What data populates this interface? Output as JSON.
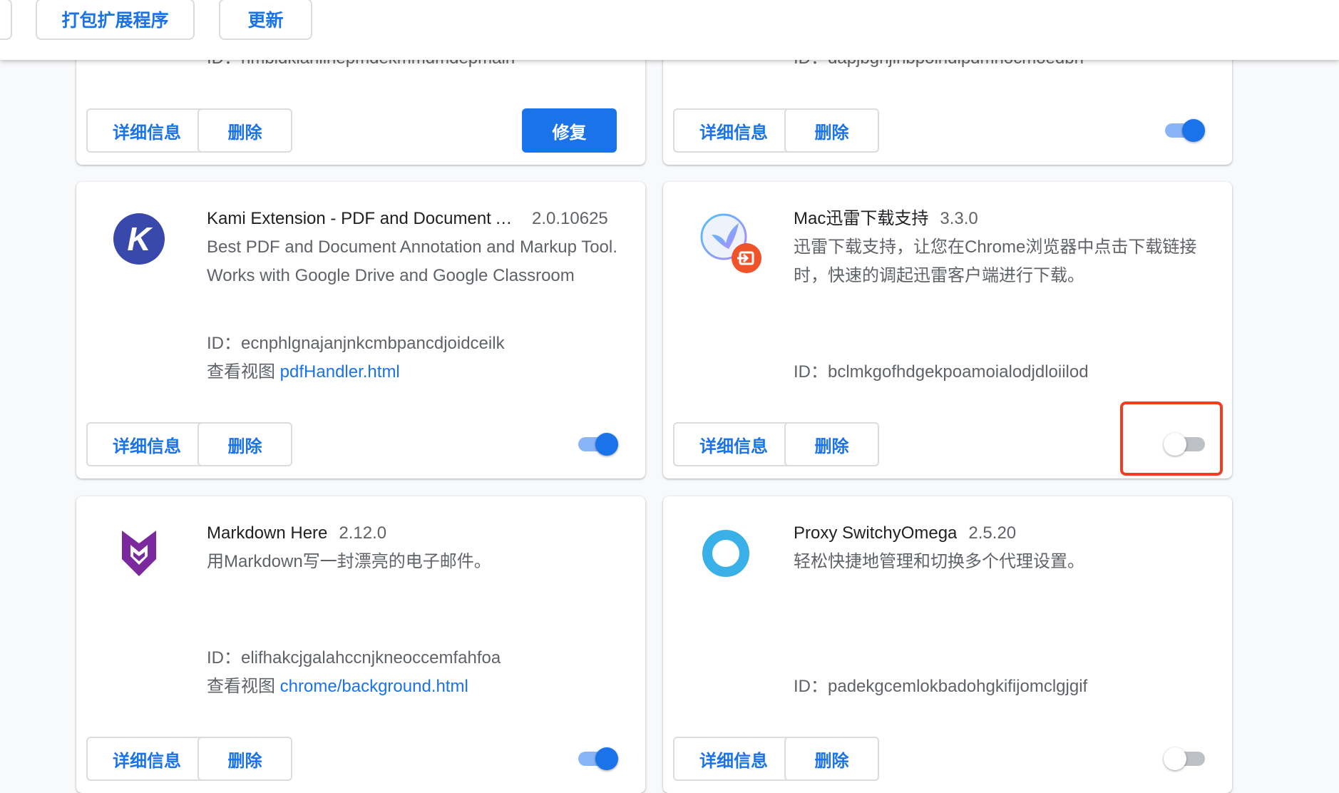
{
  "toolbar": {
    "pack_label": "打包扩展程序",
    "update_label": "更新"
  },
  "common": {
    "details_label": "详细信息",
    "remove_label": "删除",
    "repair_label": "修复",
    "view_label": "查看视图"
  },
  "extensions": [
    {
      "id_line": "ID：hmbldkianlinepmdekmmdmdepmain",
      "state": "corrupted"
    },
    {
      "id_line": "ID：dapjbgnjinbpoindipdmnocmoedbn",
      "enabled": true
    },
    {
      "name": "Kami Extension - PDF and Document Annotation",
      "version": "2.0.10625",
      "description": "Best PDF and Document Annotation and Markup Tool. Works with Google Drive and Google Classroom",
      "id_line": "ID：ecnphlgnajanjnkcmbpancdjoidceilk",
      "view_link": "pdfHandler.html",
      "enabled": true
    },
    {
      "name": "Mac迅雷下载支持",
      "version": "3.3.0",
      "description": "迅雷下载支持，让您在Chrome浏览器中点击下载链接时，快速的调起迅雷客户端进行下载。",
      "id_line": "ID：bclmkgofhdgekpoamoialodjdloiilod",
      "enabled": false
    },
    {
      "name": "Markdown Here",
      "version": "2.12.0",
      "description": "用Markdown写一封漂亮的电子邮件。",
      "id_line": "ID：elifhakcjgalahccnjkneoccemfahfoa",
      "view_link": "chrome/background.html",
      "enabled": true
    },
    {
      "name": "Proxy SwitchyOmega",
      "version": "2.5.20",
      "description": "轻松快捷地管理和切换多个代理设置。",
      "id_line": "ID：padekgcemlokbadohgkifijomclgjgif",
      "enabled": false
    }
  ],
  "colors": {
    "accent": "#1a73e8",
    "highlight": "#f03c1f"
  }
}
